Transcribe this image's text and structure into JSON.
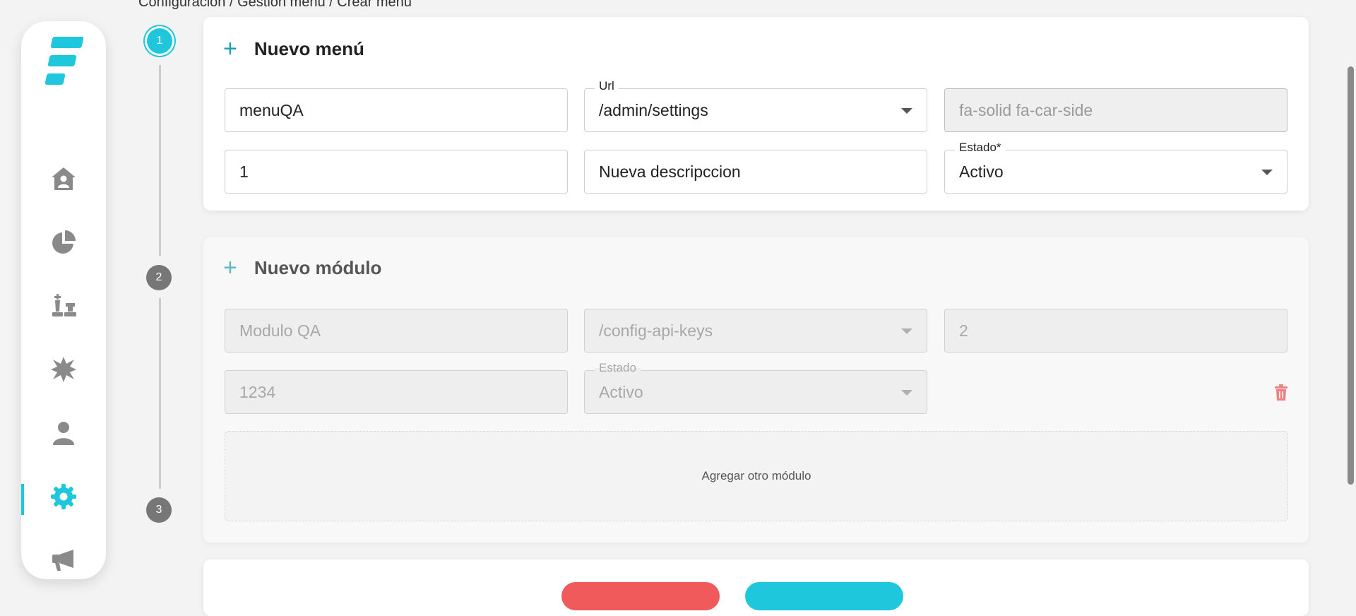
{
  "breadcrumb": "Configuración / Gestión menú / Crear menú",
  "colors": {
    "accent": "#1ec7dc",
    "danger": "#f05a5a",
    "step_inactive": "#777777"
  },
  "sidebar": {
    "items": [
      {
        "icon": "home-user-icon",
        "active": false
      },
      {
        "icon": "pie-chart-icon",
        "active": false
      },
      {
        "icon": "chess-icon",
        "active": false
      },
      {
        "icon": "burst-icon",
        "active": false
      },
      {
        "icon": "user-icon",
        "active": false
      },
      {
        "icon": "gear-icon",
        "active": true
      },
      {
        "icon": "megaphone-icon",
        "active": false
      }
    ]
  },
  "stepper": {
    "steps": [
      "1",
      "2",
      "3"
    ],
    "active_step": "1"
  },
  "menu_card": {
    "title": "Nuevo menú",
    "name_value": "menuQA",
    "url_label": "Url",
    "url_value": "/admin/settings",
    "icon_value": "fa-solid fa-car-side",
    "order_value": "1",
    "description_value": "Nueva descripccion",
    "status_label": "Estado*",
    "status_value": "Activo"
  },
  "module_card": {
    "title": "Nuevo módulo",
    "name_value": "Modulo QA",
    "url_value": "/config-api-keys",
    "order_value": "2",
    "code_value": "1234",
    "status_label": "Estado",
    "status_value": "Activo",
    "add_module_label": "Agregar otro módulo"
  }
}
